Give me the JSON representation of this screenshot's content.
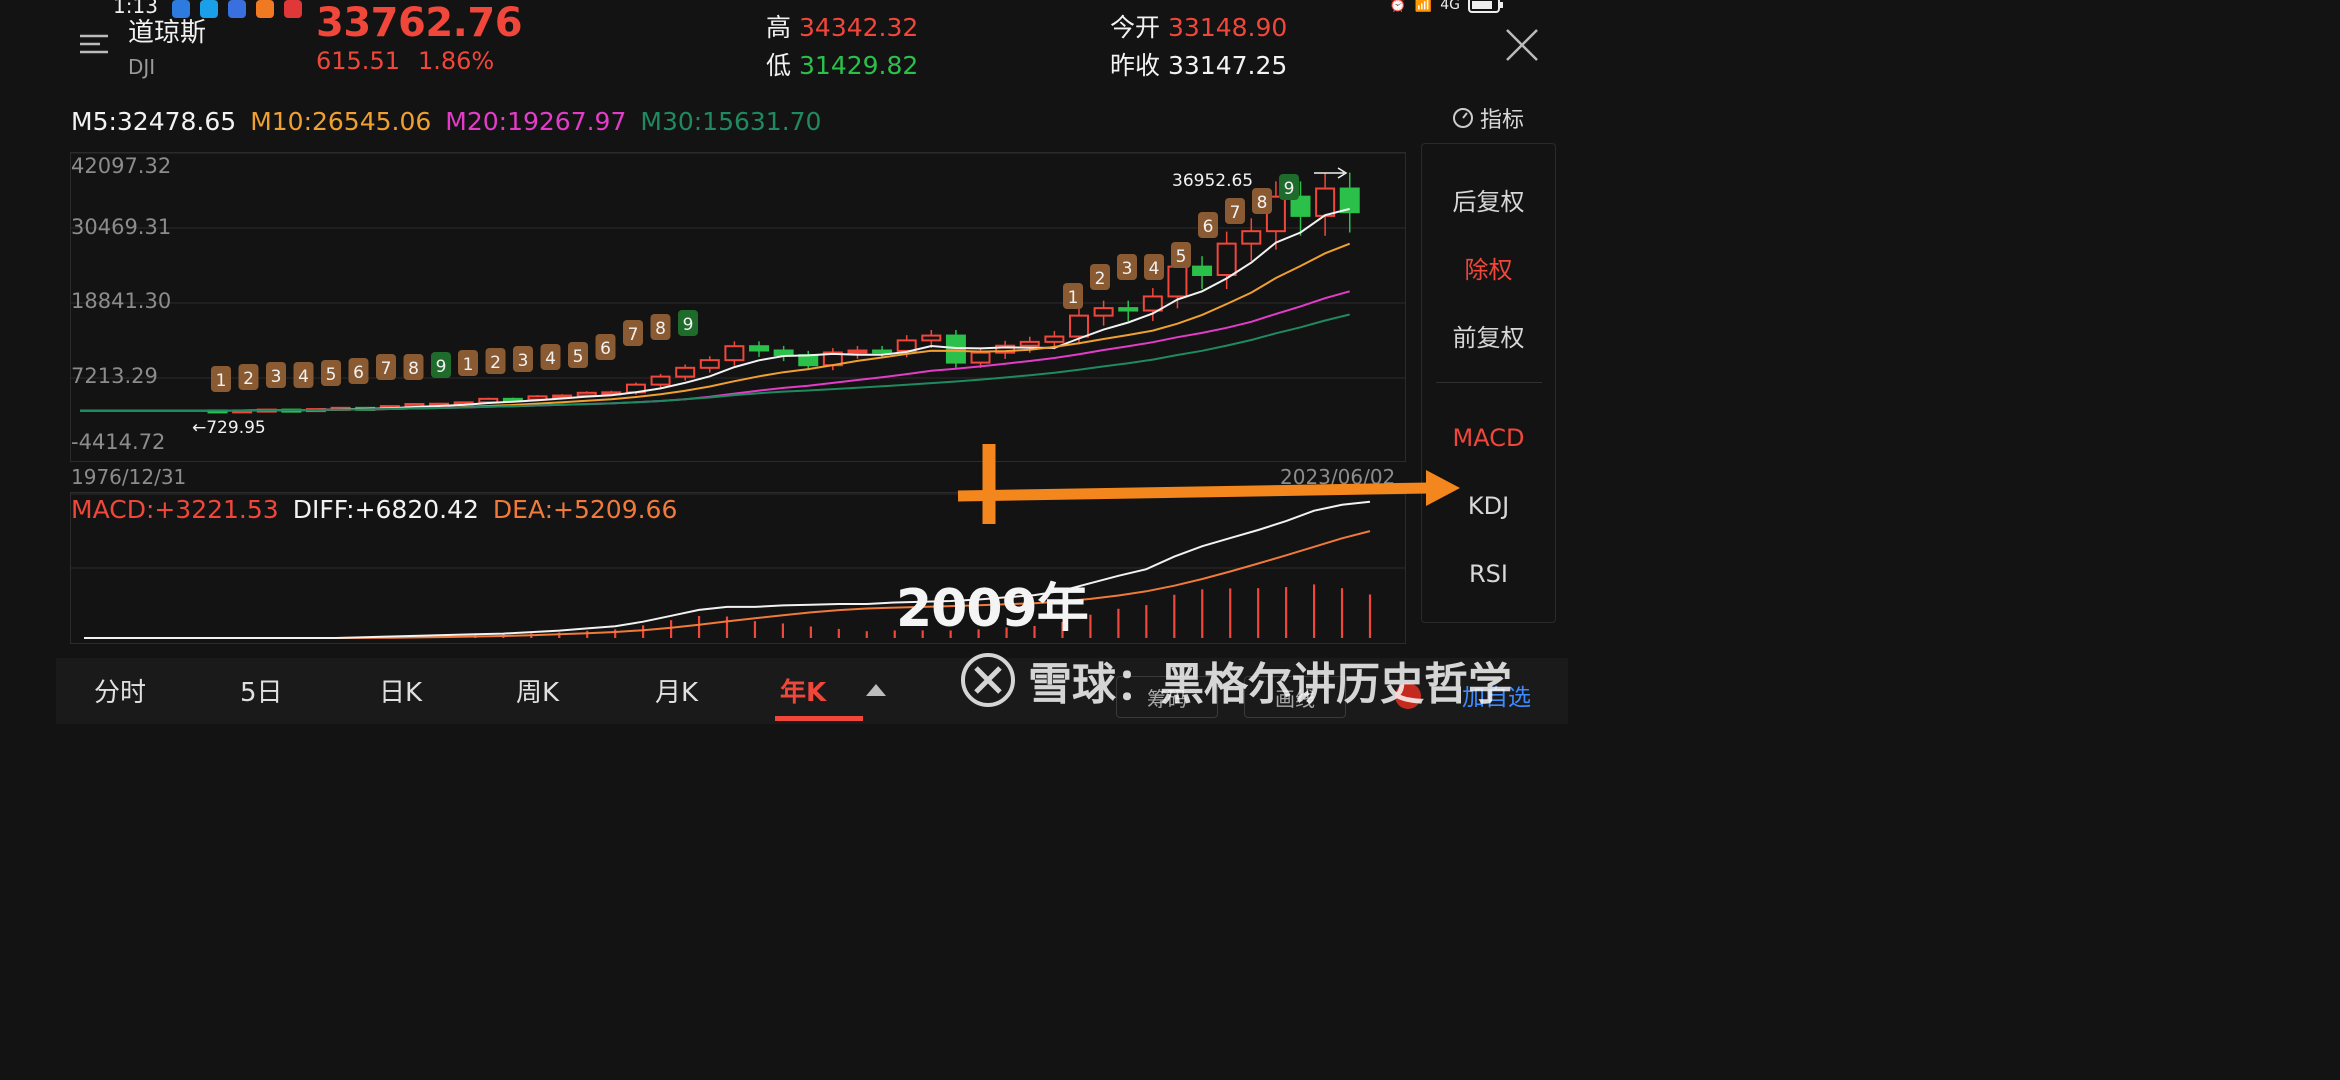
{
  "status": {
    "time": "1:13",
    "network": "4G"
  },
  "header": {
    "name": "道琼斯",
    "code": "DJI",
    "price": "33762.76",
    "change": "615.51",
    "change_pct": "1.86%",
    "high_label": "高",
    "high": "34342.32",
    "low_label": "低",
    "low": "31429.82",
    "open_label": "今开",
    "open": "33148.90",
    "prev_label": "昨收",
    "prev": "33147.25"
  },
  "ma": {
    "m5": "M5:32478.65",
    "m10": "M10:26545.06",
    "m20": "M20:19267.97",
    "m30": "M30:15631.70",
    "colors": {
      "m5": "#f2f2f2",
      "m10": "#f0a030",
      "m20": "#e33cc8",
      "m30": "#1f8a60"
    }
  },
  "indicator_button": "指标",
  "y_axis": [
    "42097.32",
    "30469.31",
    "18841.30",
    "7213.29",
    "-4414.72"
  ],
  "dates": {
    "start": "1976/12/31",
    "end": "2023/06/02"
  },
  "annotations": {
    "max": "36952.65",
    "min": "729.95"
  },
  "macd": {
    "macd": "MACD:+3221.53",
    "diff": "DIFF:+6820.42",
    "dea": "DEA:+5209.66"
  },
  "side_panel": {
    "items": [
      {
        "label": "后复权",
        "active": false
      },
      {
        "label": "除权",
        "active": true
      },
      {
        "label": "前复权",
        "active": false
      },
      {
        "label": "MACD",
        "active": true
      },
      {
        "label": "KDJ",
        "active": false
      },
      {
        "label": "RSI",
        "active": false
      }
    ]
  },
  "tabs": [
    "分时",
    "5日",
    "日K",
    "周K",
    "月K",
    "年K"
  ],
  "active_tab": "年K",
  "bottom": {
    "chip": "筹码",
    "draw": "画线",
    "add_watch": "加自选"
  },
  "overlay_text": "2009年",
  "watermark": "雪球：黑格尔讲历史哲学",
  "chart_data": {
    "type": "candlestick",
    "y_ticks": [
      42097.32,
      30469.31,
      18841.3,
      7213.29,
      -4414.72
    ],
    "ylim": [
      -4414.72,
      42097.32
    ],
    "x_range": [
      "1976/12/31",
      "2023/06/02"
    ],
    "td_counts_1": [
      "1",
      "2",
      "3",
      "4",
      "5",
      "6",
      "7",
      "8",
      "9"
    ],
    "td_counts_2": [
      "1",
      "2",
      "3",
      "4",
      "5",
      "6",
      "7",
      "8",
      "9"
    ],
    "td_counts_3": [
      "1",
      "2",
      "3",
      "4",
      "5",
      "6",
      "7",
      "8",
      "9"
    ]
  }
}
